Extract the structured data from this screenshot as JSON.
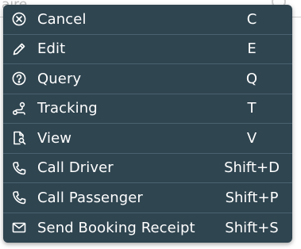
{
  "background": {
    "partial_text": "aire"
  },
  "menu": {
    "colors": {
      "background": "#2f4550",
      "divider": "#4a6270",
      "text": "#ffffff"
    },
    "items": [
      {
        "label": "Cancel",
        "shortcut": "C",
        "icon": "cancel-circle-icon"
      },
      {
        "label": "Edit",
        "shortcut": "E",
        "icon": "pencil-icon"
      },
      {
        "label": "Query",
        "shortcut": "Q",
        "icon": "question-circle-icon"
      },
      {
        "label": "Tracking",
        "shortcut": "T",
        "icon": "route-icon"
      },
      {
        "label": "View",
        "shortcut": "V",
        "icon": "document-search-icon"
      },
      {
        "label": "Call Driver",
        "shortcut": "Shift+D",
        "icon": "phone-icon"
      },
      {
        "label": "Call Passenger",
        "shortcut": "Shift+P",
        "icon": "phone-icon"
      },
      {
        "label": "Send Booking Receipt",
        "shortcut": "Shift+S",
        "icon": "envelope-icon"
      }
    ]
  }
}
